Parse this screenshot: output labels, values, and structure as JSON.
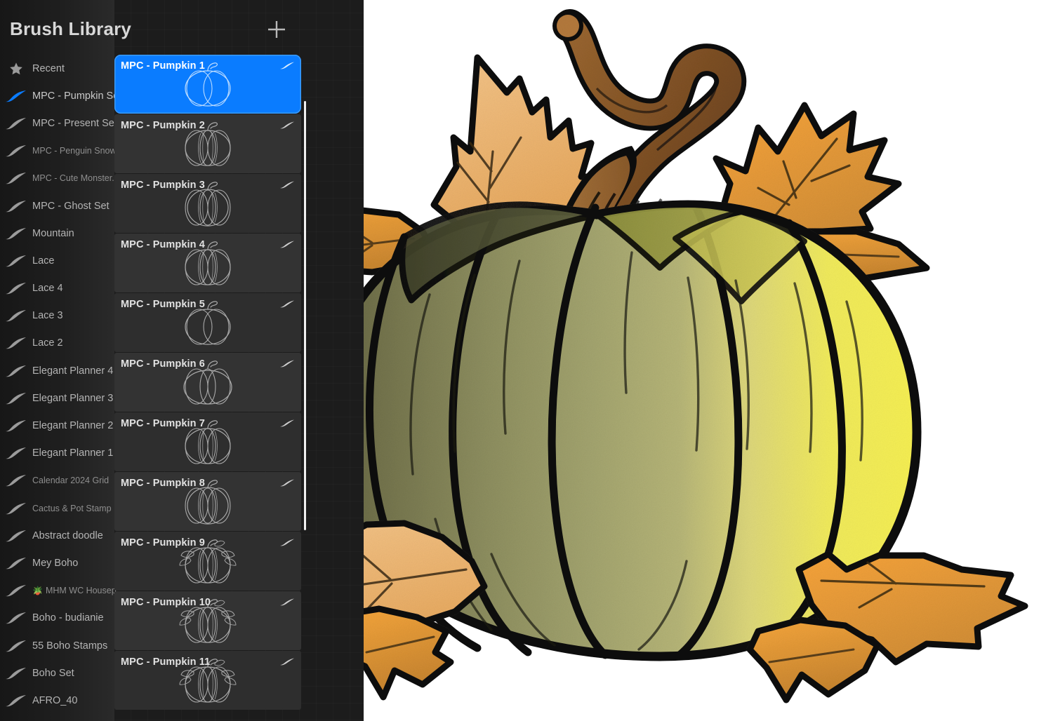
{
  "panel": {
    "title": "Brush Library",
    "add_button_icon": "plus-icon",
    "scrollbar": "card-scrollbar"
  },
  "sets": [
    {
      "label": "Recent",
      "icon": "star-icon",
      "selected": false,
      "dim": false
    },
    {
      "label": "MPC - Pumpkin Set",
      "icon": "brush-stroke-icon",
      "selected": true,
      "dim": false
    },
    {
      "label": "MPC - Present Set",
      "icon": "brush-stroke-icon",
      "selected": false,
      "dim": false
    },
    {
      "label": "MPC - Penguin Snow...",
      "icon": "brush-stroke-icon",
      "selected": false,
      "dim": true
    },
    {
      "label": "MPC - Cute Monster...",
      "icon": "brush-stroke-icon",
      "selected": false,
      "dim": true
    },
    {
      "label": "MPC - Ghost Set",
      "icon": "brush-stroke-icon",
      "selected": false,
      "dim": false
    },
    {
      "label": "Mountain",
      "icon": "brush-stroke-icon",
      "selected": false,
      "dim": false
    },
    {
      "label": "Lace",
      "icon": "brush-stroke-icon",
      "selected": false,
      "dim": false
    },
    {
      "label": "Lace 4",
      "icon": "brush-stroke-icon",
      "selected": false,
      "dim": false
    },
    {
      "label": "Lace 3",
      "icon": "brush-stroke-icon",
      "selected": false,
      "dim": false
    },
    {
      "label": "Lace 2",
      "icon": "brush-stroke-icon",
      "selected": false,
      "dim": false
    },
    {
      "label": "Elegant Planner 4",
      "icon": "brush-stroke-icon",
      "selected": false,
      "dim": false
    },
    {
      "label": "Elegant Planner 3",
      "icon": "brush-stroke-icon",
      "selected": false,
      "dim": false
    },
    {
      "label": "Elegant Planner 2",
      "icon": "brush-stroke-icon",
      "selected": false,
      "dim": false
    },
    {
      "label": "Elegant Planner 1",
      "icon": "brush-stroke-icon",
      "selected": false,
      "dim": false
    },
    {
      "label": "Calendar 2024 Grid",
      "icon": "brush-stroke-icon",
      "selected": false,
      "dim": true
    },
    {
      "label": "Cactus & Pot Stamp",
      "icon": "brush-stroke-icon",
      "selected": false,
      "dim": true
    },
    {
      "label": "Abstract doodle",
      "icon": "brush-stroke-icon",
      "selected": false,
      "dim": false
    },
    {
      "label": "Mey Boho",
      "icon": "brush-stroke-icon",
      "selected": false,
      "dim": false
    },
    {
      "label": "MHM WC Housep...",
      "icon": "brush-stroke-icon",
      "emoji": "🪴",
      "selected": false,
      "dim": true
    },
    {
      "label": "Boho - budianie",
      "icon": "brush-stroke-icon",
      "selected": false,
      "dim": false
    },
    {
      "label": "55 Boho Stamps",
      "icon": "brush-stroke-icon",
      "selected": false,
      "dim": false
    },
    {
      "label": "Boho Set",
      "icon": "brush-stroke-icon",
      "selected": false,
      "dim": false
    },
    {
      "label": "AFRO_40",
      "icon": "brush-stroke-icon",
      "selected": false,
      "dim": false
    }
  ],
  "brushes": [
    {
      "name": "MPC - Pumpkin 1",
      "selected": true,
      "thumb": "pumpkin-plain"
    },
    {
      "name": "MPC - Pumpkin 2",
      "selected": false,
      "thumb": "pumpkin-ribbed"
    },
    {
      "name": "MPC - Pumpkin 3",
      "selected": false,
      "thumb": "pumpkin-tall"
    },
    {
      "name": "MPC - Pumpkin 4",
      "selected": false,
      "thumb": "pumpkin-ribbed"
    },
    {
      "name": "MPC - Pumpkin 5",
      "selected": false,
      "thumb": "pumpkin-plain"
    },
    {
      "name": "MPC - Pumpkin 6",
      "selected": false,
      "thumb": "pumpkin-round"
    },
    {
      "name": "MPC - Pumpkin 7",
      "selected": false,
      "thumb": "pumpkin-ribbed"
    },
    {
      "name": "MPC - Pumpkin 8",
      "selected": false,
      "thumb": "pumpkin-tall"
    },
    {
      "name": "MPC - Pumpkin 9",
      "selected": false,
      "thumb": "pumpkin-leaves"
    },
    {
      "name": "MPC - Pumpkin 10",
      "selected": false,
      "thumb": "pumpkin-leaves"
    },
    {
      "name": "MPC - Pumpkin 11",
      "selected": false,
      "thumb": "pumpkin-leaves"
    }
  ],
  "colors": {
    "accent_blue": "#0a7cff",
    "panel_background": "#1c1c1c",
    "card_background": "#2e2e2e",
    "canvas_background": "#ffffff",
    "pumpkin_shadow_green": "#6b6c4a",
    "pumpkin_mid_olive": "#989a6c",
    "pumpkin_light_olive": "#b0b07c",
    "pumpkin_yellow": "#f2ea4e",
    "pumpkin_pale_yellow": "#e9e58a",
    "stem_brown": "#8a5a2b",
    "stem_dark_brown": "#6d4420",
    "leaf_tan": "#eeb772",
    "leaf_orange": "#f0a040",
    "leaf_dark_orange": "#c88a35",
    "outline_black": "#0d0d0d"
  },
  "artwork": {
    "title": "pumpkin-illustration",
    "description": "Hand drawn pumpkin with curling stem and autumn maple leaves"
  }
}
